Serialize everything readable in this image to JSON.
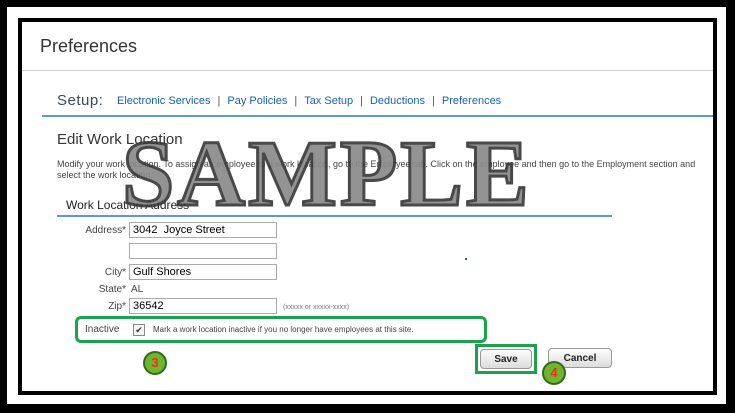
{
  "header": {
    "title": "Preferences"
  },
  "setup": {
    "label": "Setup:",
    "links": [
      "Electronic Services",
      "Pay Policies",
      "Tax Setup",
      "Deductions",
      "Preferences"
    ],
    "separator": "|"
  },
  "section": {
    "title": "Edit Work Location",
    "description": "Modify your work location. To assign an employee to a work location, go to the Employee tab. Click on the employee and then go to the Employment section and select the work location."
  },
  "address_form": {
    "subtitle": "Work Location Address",
    "address_label": "Address*",
    "address_value": "3042  Joyce Street",
    "address2_value": "",
    "city_label": "City*",
    "city_value": "Gulf Shores",
    "state_label": "State*",
    "state_value": "AL",
    "zip_label": "Zip*",
    "zip_value": "36542",
    "zip_hint": "(xxxxx or xxxxx-xxxx)"
  },
  "inactive": {
    "label": "Inactive",
    "checked": true,
    "check_glyph": "✔",
    "message": "Mark a work location inactive if you no longer have employees at this site."
  },
  "callouts": {
    "step3": "3",
    "step4": "4"
  },
  "buttons": {
    "save": "Save",
    "cancel": "Cancel"
  },
  "watermark": "SAMPLE",
  "colors": {
    "link": "#1a5fb4",
    "accent_rule": "#5b9bd5",
    "highlight": "#1aa34a",
    "badge_fill": "#6fb530",
    "badge_text": "#e8321d"
  }
}
